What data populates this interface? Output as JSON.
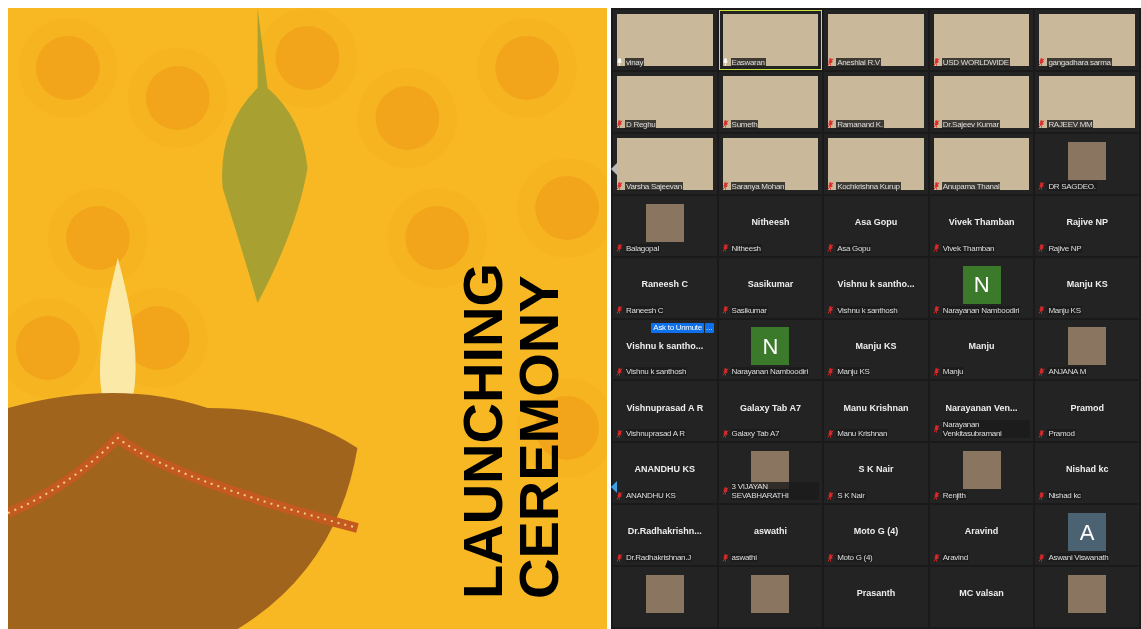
{
  "poster": {
    "title_lines": [
      "LAUNCHING",
      "CEREMONY"
    ]
  },
  "gallery": {
    "tiles": [
      {
        "kind": "video",
        "label": "vinay",
        "muted": false,
        "speaking": false
      },
      {
        "kind": "video",
        "label": "Easwaran",
        "muted": false,
        "speaking": true
      },
      {
        "kind": "video",
        "label": "Aneshlal R.V",
        "muted": true,
        "speaking": false
      },
      {
        "kind": "video",
        "label": "USD WORLDWIDE",
        "muted": true,
        "speaking": false
      },
      {
        "kind": "video",
        "label": "gangadhara sarma",
        "muted": true,
        "speaking": false
      },
      {
        "kind": "video",
        "label": "D Reghu",
        "muted": true,
        "speaking": false
      },
      {
        "kind": "video",
        "label": "Sumeth",
        "muted": true,
        "speaking": false
      },
      {
        "kind": "video",
        "label": "Ramanand K.",
        "muted": true,
        "speaking": false
      },
      {
        "kind": "video",
        "label": "Dr.Sajeev Kumar",
        "muted": true,
        "speaking": false
      },
      {
        "kind": "video",
        "label": "RAJEEV MM",
        "muted": true,
        "speaking": false
      },
      {
        "kind": "video",
        "label": "Varsha Sajeevan",
        "muted": true,
        "speaking": false
      },
      {
        "kind": "video",
        "label": "Saranya Mohan",
        "muted": true,
        "speaking": false
      },
      {
        "kind": "video",
        "label": "Kochkrishna Kurup",
        "muted": true,
        "speaking": false
      },
      {
        "kind": "video",
        "label": "Anupama Thanal",
        "muted": true,
        "speaking": false
      },
      {
        "kind": "picture",
        "label": "DR SAGDEO.",
        "muted": true,
        "speaking": false
      },
      {
        "kind": "picture",
        "label": "Balagopal",
        "muted": true,
        "speaking": false
      },
      {
        "kind": "name",
        "name": "Nitheesh",
        "label": "Nitheesh",
        "muted": true,
        "speaking": false
      },
      {
        "kind": "name",
        "name": "Asa Gopu",
        "label": "Asa Gopu",
        "muted": true,
        "speaking": false
      },
      {
        "kind": "name",
        "name": "Vivek Thamban",
        "label": "Vivek Thamban",
        "muted": true,
        "speaking": false
      },
      {
        "kind": "name",
        "name": "Rajive NP",
        "label": "Rajive NP",
        "muted": true,
        "speaking": false
      },
      {
        "kind": "name",
        "name": "Raneesh C",
        "label": "Raneesh C",
        "muted": true,
        "speaking": false
      },
      {
        "kind": "name",
        "name": "Sasikumar",
        "label": "Sasikumar",
        "muted": true,
        "speaking": false
      },
      {
        "kind": "name",
        "name": "Vishnu  k  santho...",
        "label": "Vishnu k santhosh",
        "muted": true,
        "speaking": false
      },
      {
        "kind": "avatar",
        "initial": "N",
        "color": "#3a7a2a",
        "label": "Narayanan Namboodiri",
        "muted": true,
        "speaking": false
      },
      {
        "kind": "name",
        "name": "Manju KS",
        "label": "Manju KS",
        "muted": true,
        "speaking": false
      },
      {
        "kind": "name",
        "name": "Vishnu  k  santho...",
        "label": "Vishnu k santhosh",
        "muted": true,
        "speaking": false,
        "action": "Ask to Unmute",
        "more": "..."
      },
      {
        "kind": "avatar",
        "initial": "N",
        "color": "#3a7a2a",
        "label": "Narayanan Namboodiri",
        "muted": true,
        "speaking": false
      },
      {
        "kind": "name",
        "name": "Manju KS",
        "label": "Manju KS",
        "muted": true,
        "speaking": false
      },
      {
        "kind": "name",
        "name": "Manju",
        "label": "Manju",
        "muted": true,
        "speaking": false
      },
      {
        "kind": "picture",
        "label": "ANJANA M",
        "muted": true,
        "speaking": false
      },
      {
        "kind": "name",
        "name": "Vishnuprasad A R",
        "label": "Vishnuprasad A R",
        "muted": true,
        "speaking": false
      },
      {
        "kind": "name",
        "name": "Galaxy Tab A7",
        "label": "Galaxy Tab A7",
        "muted": true,
        "speaking": false
      },
      {
        "kind": "name",
        "name": "Manu Krishnan",
        "label": "Manu Krishnan",
        "muted": true,
        "speaking": false
      },
      {
        "kind": "name",
        "name": "Narayanan  Ven...",
        "label": "Narayanan Venkitasubramani",
        "muted": true,
        "speaking": false
      },
      {
        "kind": "name",
        "name": "Pramod",
        "label": "Pramod",
        "muted": true,
        "speaking": false
      },
      {
        "kind": "name",
        "name": "ANANDHU KS",
        "label": "ANANDHU KS",
        "muted": true,
        "speaking": false
      },
      {
        "kind": "picture",
        "label": "3 VIJAYAN SEVABHARATHI",
        "muted": true,
        "speaking": false
      },
      {
        "kind": "name",
        "name": "S K Nair",
        "label": "S K Nair",
        "muted": true,
        "speaking": false
      },
      {
        "kind": "picture",
        "label": "Renjith",
        "muted": true,
        "speaking": false
      },
      {
        "kind": "name",
        "name": "Nishad kc",
        "label": "Nishad kc",
        "muted": true,
        "speaking": false
      },
      {
        "kind": "name",
        "name": "Dr.Radhakrishn...",
        "label": "Dr.Radhakrishnan.J",
        "muted": true,
        "speaking": false
      },
      {
        "kind": "name",
        "name": "aswathi",
        "label": "aswathi",
        "muted": true,
        "speaking": false
      },
      {
        "kind": "name",
        "name": "Moto G (4)",
        "label": "Moto G (4)",
        "muted": true,
        "speaking": false
      },
      {
        "kind": "name",
        "name": "Aravind",
        "label": "Aravind",
        "muted": true,
        "speaking": false
      },
      {
        "kind": "avatar",
        "initial": "A",
        "color": "#4a6272",
        "label": "Aswani Viswanath",
        "muted": true,
        "speaking": false
      },
      {
        "kind": "picture",
        "speaking": false
      },
      {
        "kind": "picture",
        "speaking": false
      },
      {
        "kind": "name",
        "name": "Prasanth",
        "speaking": false
      },
      {
        "kind": "name",
        "name": "MC valsan",
        "speaking": false
      },
      {
        "kind": "picture",
        "speaking": false
      }
    ]
  }
}
